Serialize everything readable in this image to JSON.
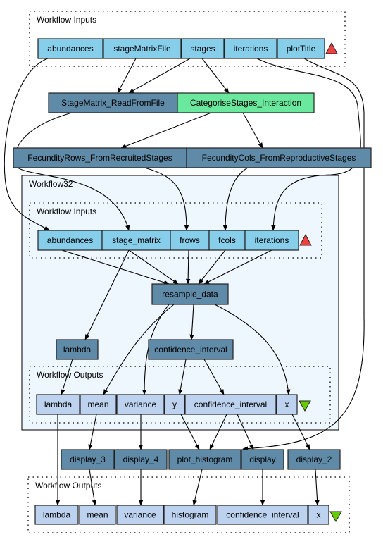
{
  "colors": {
    "input": "#87ceeb",
    "processor": "#5f8ba8",
    "interaction": "#6ae89e",
    "output": "#bcd2ee",
    "nested_bg": "#eef6fe",
    "input_marker": "#f04040",
    "output_marker": "#66cc00"
  },
  "top_inputs": {
    "title": "Workflow Inputs",
    "ports": [
      "abundances",
      "stageMatrixFile",
      "stages",
      "iterations",
      "plotTitle"
    ],
    "marker_icon": "triangle-up-icon"
  },
  "processors_top": [
    "StageMatrix_ReadFromFile",
    "CategoriseStages_Interaction",
    "FecundityRows_FromRecruitedStages",
    "FecundityCols_FromReproductiveStages"
  ],
  "nested": {
    "title": "Workflow32",
    "inputs": {
      "title": "Workflow Inputs",
      "ports": [
        "abundances",
        "stage_matrix",
        "frows",
        "fcols",
        "iterations"
      ]
    },
    "processors": [
      "resample_data",
      "lambda",
      "confidence_interval"
    ],
    "outputs": {
      "title": "Workflow Outputs",
      "ports": [
        "lambda",
        "mean",
        "variance",
        "y",
        "confidence_interval",
        "x"
      ]
    }
  },
  "processors_bottom": [
    "display_3",
    "display_4",
    "plot_histogram",
    "display",
    "display_2"
  ],
  "bottom_outputs": {
    "title": "Workflow Outputs",
    "ports": [
      "lambda",
      "mean",
      "variance",
      "histogram",
      "confidence_interval",
      "x"
    ],
    "marker_icon": "triangle-down-icon"
  }
}
